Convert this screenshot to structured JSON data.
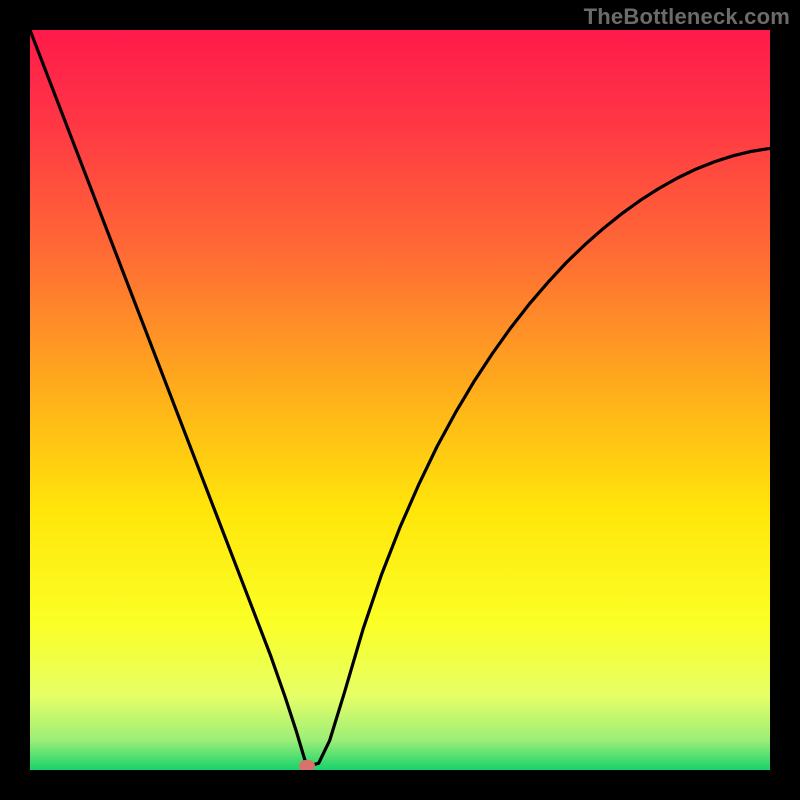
{
  "watermark": {
    "text": "TheBottleneck.com"
  },
  "marker": {
    "color": "#d6746c",
    "x_frac": 0.374,
    "y_frac": 0.995
  },
  "gradient_stops": [
    {
      "pos": 0.0,
      "color": "#ff1a4b"
    },
    {
      "pos": 0.12,
      "color": "#ff3545"
    },
    {
      "pos": 0.3,
      "color": "#ff6a35"
    },
    {
      "pos": 0.5,
      "color": "#ffb219"
    },
    {
      "pos": 0.65,
      "color": "#ffe60a"
    },
    {
      "pos": 0.8,
      "color": "#fbff25"
    },
    {
      "pos": 0.9,
      "color": "#e6ff66"
    },
    {
      "pos": 0.96,
      "color": "#9bee78"
    },
    {
      "pos": 1.0,
      "color": "#17d36b"
    }
  ],
  "chart_data": {
    "type": "line",
    "title": "",
    "xlabel": "",
    "ylabel": "",
    "xlim": [
      0,
      100
    ],
    "ylim": [
      0,
      100
    ],
    "grid": false,
    "legend": false,
    "series": [
      {
        "name": "bottleneck-curve",
        "x": [
          0.0,
          2.5,
          5.0,
          7.5,
          10.0,
          12.5,
          15.0,
          17.5,
          20.0,
          22.5,
          25.0,
          27.5,
          30.0,
          32.5,
          34.5,
          36.0,
          37.4,
          39.0,
          40.5,
          42.5,
          45.0,
          47.5,
          50.0,
          52.5,
          55.0,
          57.5,
          60.0,
          62.5,
          65.0,
          67.5,
          70.0,
          72.5,
          75.0,
          77.5,
          80.0,
          82.5,
          85.0,
          87.5,
          90.0,
          92.5,
          95.0,
          97.5,
          100.0
        ],
        "y": [
          100.0,
          93.5,
          87.0,
          80.5,
          74.0,
          67.5,
          61.0,
          54.5,
          48.0,
          41.5,
          35.0,
          28.5,
          22.0,
          15.5,
          9.8,
          5.2,
          0.5,
          0.9,
          4.0,
          10.5,
          19.0,
          26.4,
          32.8,
          38.5,
          43.7,
          48.3,
          52.5,
          56.3,
          59.8,
          63.0,
          65.9,
          68.6,
          71.0,
          73.2,
          75.2,
          77.0,
          78.6,
          80.0,
          81.2,
          82.2,
          83.0,
          83.6,
          84.0
        ]
      }
    ],
    "marker_point": {
      "x": 37.4,
      "y": 0.5
    }
  }
}
